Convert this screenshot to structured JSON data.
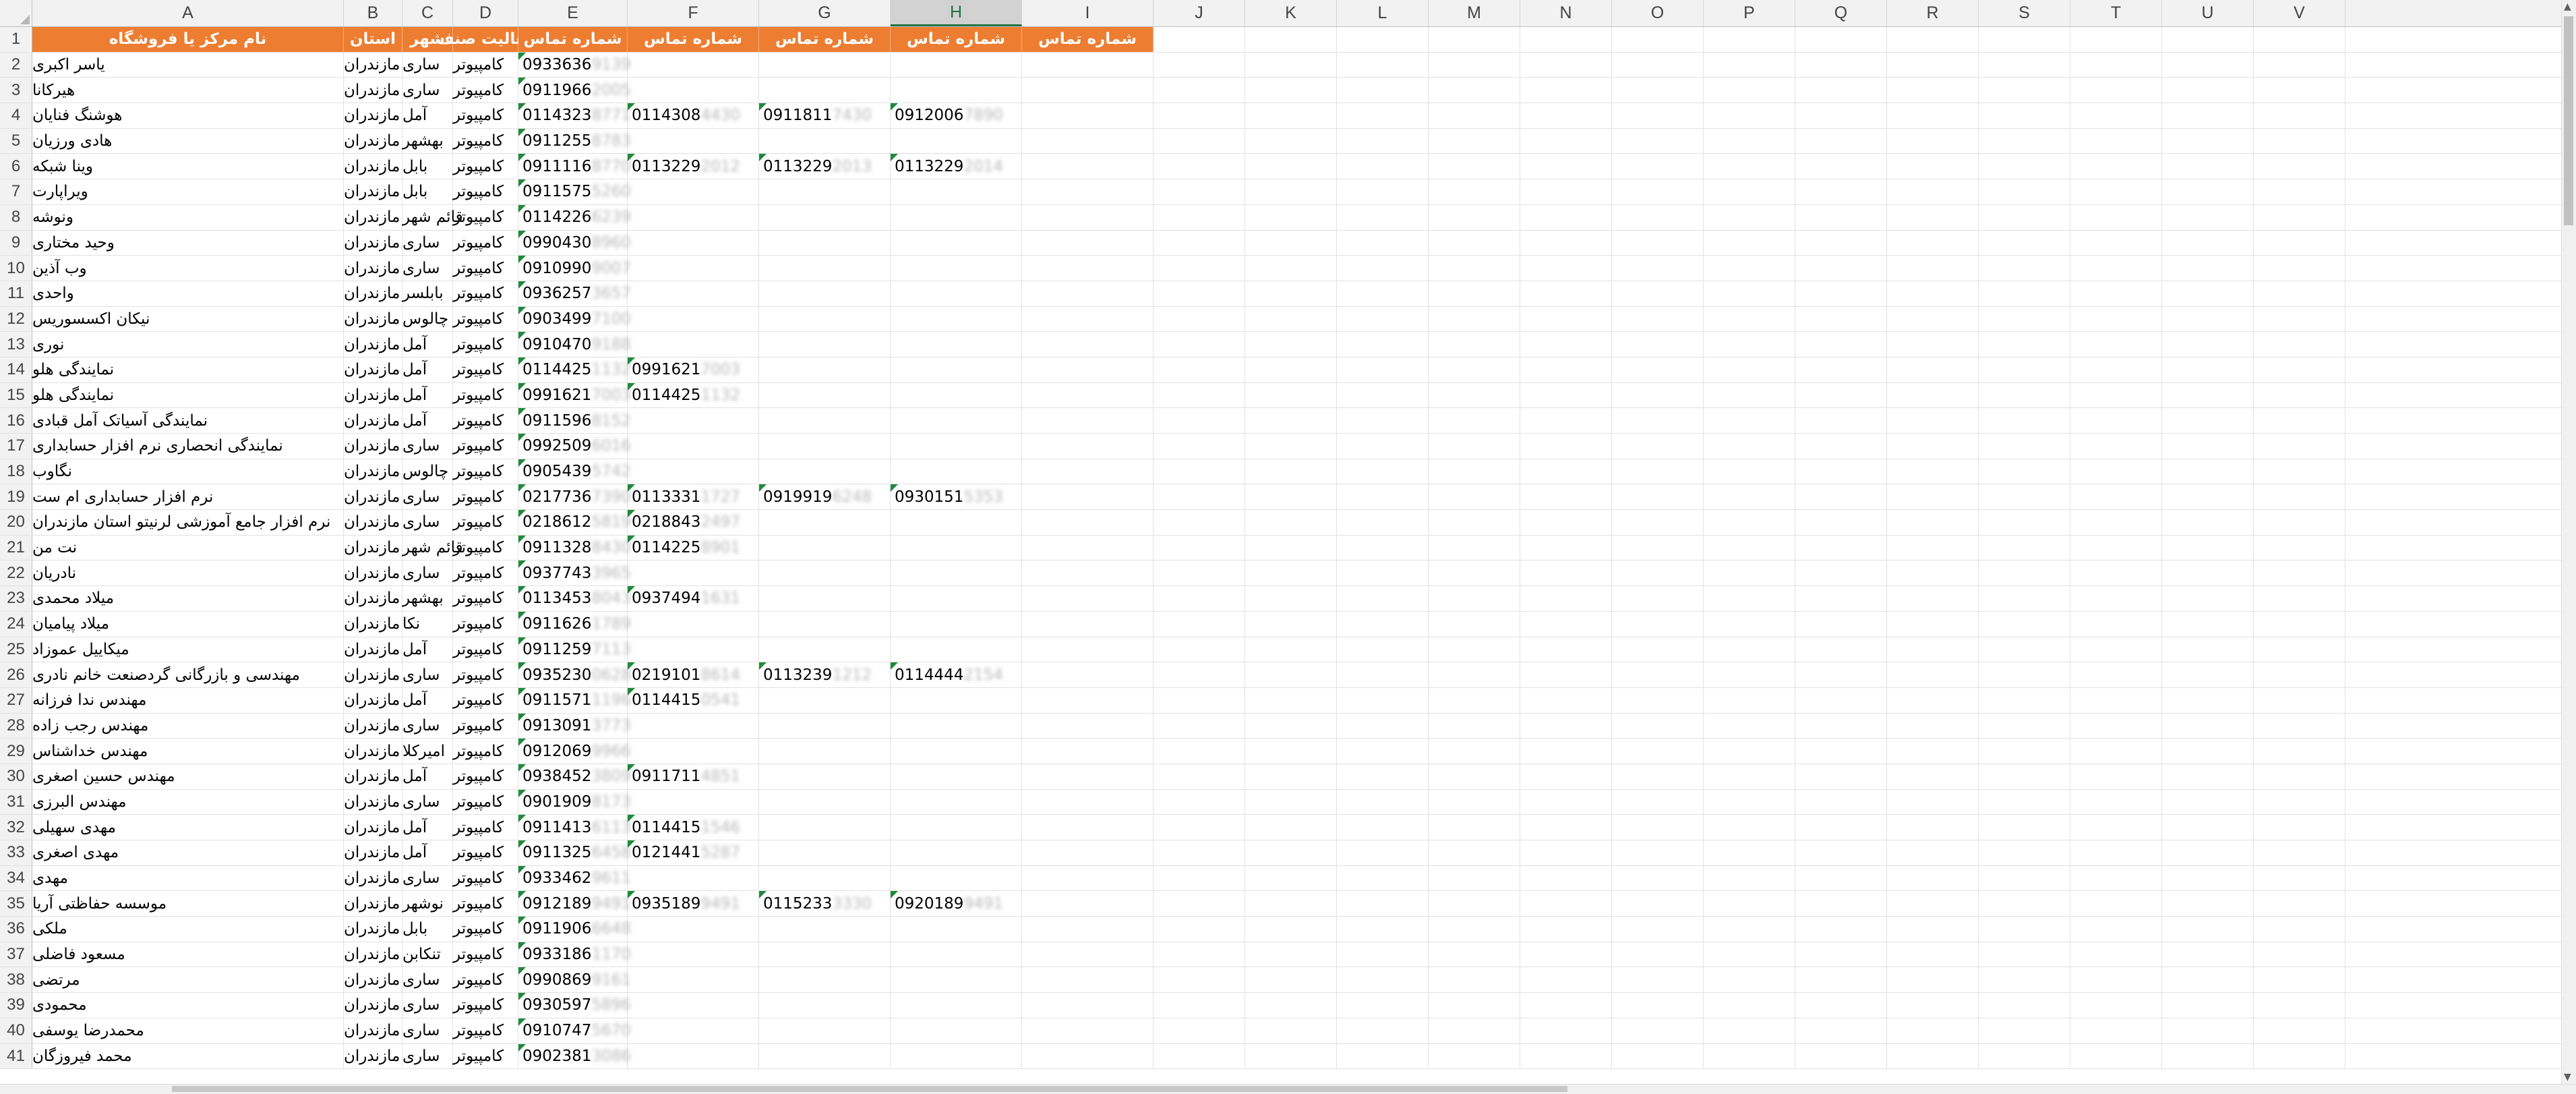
{
  "columns": [
    "A",
    "B",
    "C",
    "D",
    "E",
    "F",
    "G",
    "H",
    "I",
    "J",
    "K",
    "L",
    "M",
    "N",
    "O",
    "P",
    "Q",
    "R",
    "S",
    "T",
    "U",
    "V"
  ],
  "selected_column": "H",
  "header_row": [
    "نام مرکز یا فروشگاه",
    "استان",
    "شهر",
    "فعالیت صنف",
    "شماره تماس",
    "شماره تماس",
    "شماره تماس",
    "شماره تماس",
    "شماره تماس"
  ],
  "rows": [
    {
      "n": "2",
      "a": "یاسر اکبری",
      "b": "مازندران",
      "c": "ساری",
      "d": "کامپیوتر",
      "e": "0933636",
      "eb": "9139",
      "f": "",
      "fb": "",
      "g": "",
      "gb": "",
      "h": "",
      "hb": ""
    },
    {
      "n": "3",
      "a": "هیرکانا",
      "b": "مازندران",
      "c": "ساری",
      "d": "کامپیوتر",
      "e": "0911966",
      "eb": "2005",
      "f": "",
      "fb": "",
      "g": "",
      "gb": "",
      "h": "",
      "hb": ""
    },
    {
      "n": "4",
      "a": "هوشنگ فنایان",
      "b": "مازندران",
      "c": "آمل",
      "d": "کامپیوتر",
      "e": "0114323",
      "eb": "8771",
      "f": "0114308",
      "fb": "4430",
      "g": "0911811",
      "gb": "7430",
      "h": "0912006",
      "hb": "7890"
    },
    {
      "n": "5",
      "a": "هادی ورزیان",
      "b": "مازندران",
      "c": "بهشهر",
      "d": "کامپیوتر",
      "e": "0911255",
      "eb": "8783",
      "f": "",
      "fb": "",
      "g": "",
      "gb": "",
      "h": "",
      "hb": ""
    },
    {
      "n": "6",
      "a": "وینا شبکه",
      "b": "مازندران",
      "c": "بابل",
      "d": "کامپیوتر",
      "e": "0911116",
      "eb": "8770",
      "f": "0113229",
      "fb": "2012",
      "g": "0113229",
      "gb": "2013",
      "h": "0113229",
      "hb": "2014"
    },
    {
      "n": "7",
      "a": "ویراپارت",
      "b": "مازندران",
      "c": "بابل",
      "d": "کامپیوتر",
      "e": "0911575",
      "eb": "5260",
      "f": "",
      "fb": "",
      "g": "",
      "gb": "",
      "h": "",
      "hb": ""
    },
    {
      "n": "8",
      "a": "ونوشه",
      "b": "مازندران",
      "c": "قائم شهر",
      "d": "کامپیوتر",
      "e": "0114226",
      "eb": "6239",
      "f": "",
      "fb": "",
      "g": "",
      "gb": "",
      "h": "",
      "hb": ""
    },
    {
      "n": "9",
      "a": "وحید مختاری",
      "b": "مازندران",
      "c": "ساری",
      "d": "کامپیوتر",
      "e": "0990430",
      "eb": "8960",
      "f": "",
      "fb": "",
      "g": "",
      "gb": "",
      "h": "",
      "hb": ""
    },
    {
      "n": "10",
      "a": "وب آذین",
      "b": "مازندران",
      "c": "ساری",
      "d": "کامپیوتر",
      "e": "0910990",
      "eb": "9007",
      "f": "",
      "fb": "",
      "g": "",
      "gb": "",
      "h": "",
      "hb": ""
    },
    {
      "n": "11",
      "a": "واحدی",
      "b": "مازندران",
      "c": "بابلسر",
      "d": "کامپیوتر",
      "e": "0936257",
      "eb": "3657",
      "f": "",
      "fb": "",
      "g": "",
      "gb": "",
      "h": "",
      "hb": ""
    },
    {
      "n": "12",
      "a": "نیکان اکسسوریس",
      "b": "مازندران",
      "c": "چالوس",
      "d": "کامپیوتر",
      "e": "0903499",
      "eb": "7100",
      "f": "",
      "fb": "",
      "g": "",
      "gb": "",
      "h": "",
      "hb": ""
    },
    {
      "n": "13",
      "a": "نوری",
      "b": "مازندران",
      "c": "آمل",
      "d": "کامپیوتر",
      "e": "0910470",
      "eb": "9188",
      "f": "",
      "fb": "",
      "g": "",
      "gb": "",
      "h": "",
      "hb": ""
    },
    {
      "n": "14",
      "a": "نمایندگی هلو",
      "b": "مازندران",
      "c": "آمل",
      "d": "کامپیوتر",
      "e": "0114425",
      "eb": "1132",
      "f": "0991621",
      "fb": "7003",
      "g": "",
      "gb": "",
      "h": "",
      "hb": ""
    },
    {
      "n": "15",
      "a": "نمایندگی هلو",
      "b": "مازندران",
      "c": "آمل",
      "d": "کامپیوتر",
      "e": "0991621",
      "eb": "7003",
      "f": "0114425",
      "fb": "1132",
      "g": "",
      "gb": "",
      "h": "",
      "hb": ""
    },
    {
      "n": "16",
      "a": "نمایندگی آسیاتک آمل قبادی",
      "b": "مازندران",
      "c": "آمل",
      "d": "کامپیوتر",
      "e": "0911596",
      "eb": "8152",
      "f": "",
      "fb": "",
      "g": "",
      "gb": "",
      "h": "",
      "hb": ""
    },
    {
      "n": "17",
      "a": "نمایندگی انحصاری نرم افزار حسابداری",
      "b": "مازندران",
      "c": "ساری",
      "d": "کامپیوتر",
      "e": "0992509",
      "eb": "6016",
      "f": "",
      "fb": "",
      "g": "",
      "gb": "",
      "h": "",
      "hb": ""
    },
    {
      "n": "18",
      "a": "نگاوب",
      "b": "مازندران",
      "c": "چالوس",
      "d": "کامپیوتر",
      "e": "0905439",
      "eb": "5742",
      "f": "",
      "fb": "",
      "g": "",
      "gb": "",
      "h": "",
      "hb": ""
    },
    {
      "n": "19",
      "a": "نرم افزار حسابداری ام ست",
      "b": "مازندران",
      "c": "ساری",
      "d": "کامپیوتر",
      "e": "0217736",
      "eb": "7390",
      "f": "0113331",
      "fb": "1727",
      "g": "0919919",
      "gb": "6248",
      "h": "0930151",
      "hb": "5353"
    },
    {
      "n": "20",
      "a": "نرم افزار جامع آموزشی لرنیتو استان مازندران",
      "b": "مازندران",
      "c": "ساری",
      "d": "کامپیوتر",
      "e": "0218612",
      "eb": "5819",
      "f": "0218843",
      "fb": "2497",
      "g": "",
      "gb": "",
      "h": "",
      "hb": ""
    },
    {
      "n": "21",
      "a": "نت من",
      "b": "مازندران",
      "c": "قائم شهر",
      "d": "کامپیوتر",
      "e": "0911328",
      "eb": "8430",
      "f": "0114225",
      "fb": "8901",
      "g": "",
      "gb": "",
      "h": "",
      "hb": ""
    },
    {
      "n": "22",
      "a": "نادریان",
      "b": "مازندران",
      "c": "ساری",
      "d": "کامپیوتر",
      "e": "0937743",
      "eb": "3965",
      "f": "",
      "fb": "",
      "g": "",
      "gb": "",
      "h": "",
      "hb": ""
    },
    {
      "n": "23",
      "a": "میلاد محمدی",
      "b": "مازندران",
      "c": "بهشهر",
      "d": "کامپیوتر",
      "e": "0113453",
      "eb": "8043",
      "f": "0937494",
      "fb": "1631",
      "g": "",
      "gb": "",
      "h": "",
      "hb": ""
    },
    {
      "n": "24",
      "a": "میلاد پیامیان",
      "b": "مازندران",
      "c": "نکا",
      "d": "کامپیوتر",
      "e": "0911626",
      "eb": "1789",
      "f": "",
      "fb": "",
      "g": "",
      "gb": "",
      "h": "",
      "hb": ""
    },
    {
      "n": "25",
      "a": "میکاییل عموزاد",
      "b": "مازندران",
      "c": "آمل",
      "d": "کامپیوتر",
      "e": "0911259",
      "eb": "7113",
      "f": "",
      "fb": "",
      "g": "",
      "gb": "",
      "h": "",
      "hb": ""
    },
    {
      "n": "26",
      "a": "مهندسی و بازرگانی گردصنعت خانم نادری",
      "b": "مازندران",
      "c": "ساری",
      "d": "کامپیوتر",
      "e": "0935230",
      "eb": "0628",
      "f": "0219101",
      "fb": "8614",
      "g": "0113239",
      "gb": "1212",
      "h": "0114444",
      "hb": "2154"
    },
    {
      "n": "27",
      "a": "مهندس ندا فرزانه",
      "b": "مازندران",
      "c": "آمل",
      "d": "کامپیوتر",
      "e": "0911571",
      "eb": "1196",
      "f": "0114415",
      "fb": "0541",
      "g": "",
      "gb": "",
      "h": "",
      "hb": ""
    },
    {
      "n": "28",
      "a": "مهندس رجب زاده",
      "b": "مازندران",
      "c": "ساری",
      "d": "کامپیوتر",
      "e": "0913091",
      "eb": "3773",
      "f": "",
      "fb": "",
      "g": "",
      "gb": "",
      "h": "",
      "hb": ""
    },
    {
      "n": "29",
      "a": "مهندس خداشناس",
      "b": "مازندران",
      "c": "امیرکلا",
      "d": "کامپیوتر",
      "e": "0912069",
      "eb": "9966",
      "f": "",
      "fb": "",
      "g": "",
      "gb": "",
      "h": "",
      "hb": ""
    },
    {
      "n": "30",
      "a": "مهندس حسین اصغری",
      "b": "مازندران",
      "c": "آمل",
      "d": "کامپیوتر",
      "e": "0938452",
      "eb": "3809",
      "f": "0911711",
      "fb": "4851",
      "g": "",
      "gb": "",
      "h": "",
      "hb": ""
    },
    {
      "n": "31",
      "a": "مهندس البرزی",
      "b": "مازندران",
      "c": "ساری",
      "d": "کامپیوتر",
      "e": "0901909",
      "eb": "8173",
      "f": "",
      "fb": "",
      "g": "",
      "gb": "",
      "h": "",
      "hb": ""
    },
    {
      "n": "32",
      "a": "مهدی سهیلی",
      "b": "مازندران",
      "c": "آمل",
      "d": "کامپیوتر",
      "e": "0911413",
      "eb": "6113",
      "f": "0114415",
      "fb": "1546",
      "g": "",
      "gb": "",
      "h": "",
      "hb": ""
    },
    {
      "n": "33",
      "a": "مهدی اصغری",
      "b": "مازندران",
      "c": "آمل",
      "d": "کامپیوتر",
      "e": "0911325",
      "eb": "6458",
      "f": "0121441",
      "fb": "5287",
      "g": "",
      "gb": "",
      "h": "",
      "hb": ""
    },
    {
      "n": "34",
      "a": "مهدی",
      "b": "مازندران",
      "c": "ساری",
      "d": "کامپیوتر",
      "e": "0933462",
      "eb": "9611",
      "f": "",
      "fb": "",
      "g": "",
      "gb": "",
      "h": "",
      "hb": ""
    },
    {
      "n": "35",
      "a": "موسسه حفاظتی آریا",
      "b": "مازندران",
      "c": "نوشهر",
      "d": "کامپیوتر",
      "e": "0912189",
      "eb": "9491",
      "f": "0935189",
      "fb": "9491",
      "g": "0115233",
      "gb": "3330",
      "h": "0920189",
      "hb": "9491"
    },
    {
      "n": "36",
      "a": "ملکی",
      "b": "مازندران",
      "c": "بابل",
      "d": "کامپیوتر",
      "e": "0911906",
      "eb": "6648",
      "f": "",
      "fb": "",
      "g": "",
      "gb": "",
      "h": "",
      "hb": ""
    },
    {
      "n": "37",
      "a": "مسعود فاضلی",
      "b": "مازندران",
      "c": "تنکابن",
      "d": "کامپیوتر",
      "e": "0933186",
      "eb": "1170",
      "f": "",
      "fb": "",
      "g": "",
      "gb": "",
      "h": "",
      "hb": ""
    },
    {
      "n": "38",
      "a": "مرتضی",
      "b": "مازندران",
      "c": "ساری",
      "d": "کامپیوتر",
      "e": "0990869",
      "eb": "9161",
      "f": "",
      "fb": "",
      "g": "",
      "gb": "",
      "h": "",
      "hb": ""
    },
    {
      "n": "39",
      "a": "محمودی",
      "b": "مازندران",
      "c": "ساری",
      "d": "کامپیوتر",
      "e": "0930597",
      "eb": "5896",
      "f": "",
      "fb": "",
      "g": "",
      "gb": "",
      "h": "",
      "hb": ""
    },
    {
      "n": "40",
      "a": "محمدرضا یوسفی",
      "b": "مازندران",
      "c": "ساری",
      "d": "کامپیوتر",
      "e": "0910747",
      "eb": "5670",
      "f": "",
      "fb": "",
      "g": "",
      "gb": "",
      "h": "",
      "hb": ""
    },
    {
      "n": "41",
      "a": "محمد فیروزگان",
      "b": "مازندران",
      "c": "ساری",
      "d": "کامپیوتر",
      "e": "0902381",
      "eb": "3086",
      "f": "",
      "fb": "",
      "g": "",
      "gb": "",
      "h": "",
      "hb": ""
    }
  ]
}
